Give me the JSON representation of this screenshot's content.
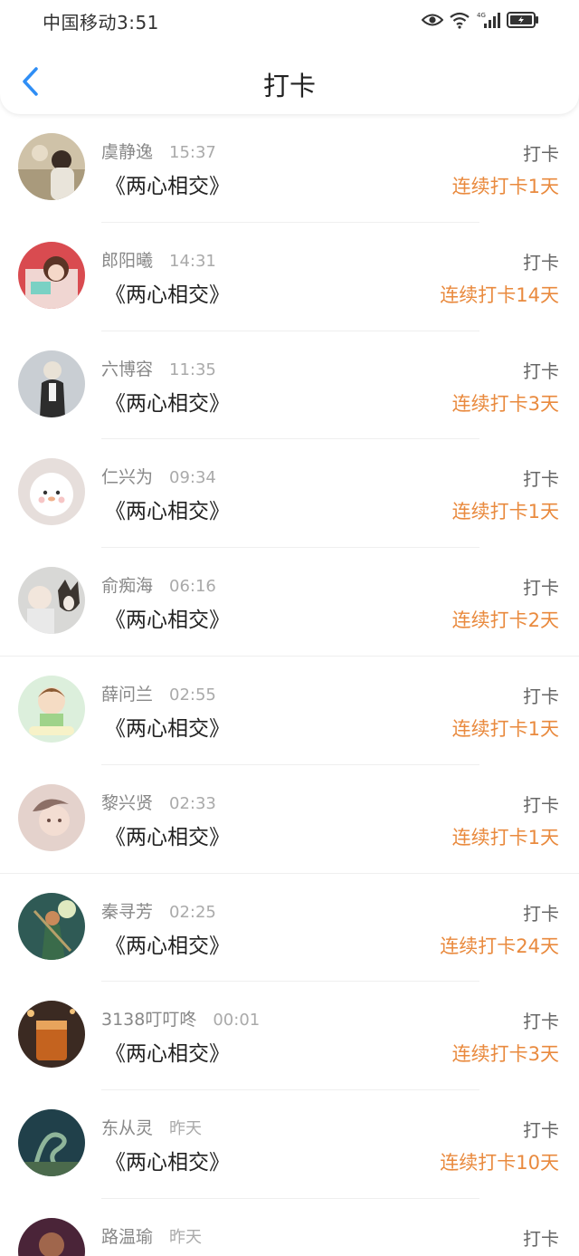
{
  "status_bar": {
    "carrier_time": "中国移动3:51",
    "network": "4G"
  },
  "nav": {
    "title": "打卡"
  },
  "colors": {
    "accent_blue": "#2f8ef5",
    "streak_orange": "#e98a3e"
  },
  "rows": [
    {
      "name": "虞静逸",
      "time": "15:37",
      "book": "《两心相交》",
      "action": "打卡",
      "streak": "连续打卡1天"
    },
    {
      "name": "郎阳曦",
      "time": "14:31",
      "book": "《两心相交》",
      "action": "打卡",
      "streak": "连续打卡14天"
    },
    {
      "name": "六博容",
      "time": "11:35",
      "book": "《两心相交》",
      "action": "打卡",
      "streak": "连续打卡3天"
    },
    {
      "name": "仁兴为",
      "time": "09:34",
      "book": "《两心相交》",
      "action": "打卡",
      "streak": "连续打卡1天"
    },
    {
      "name": "俞痴海",
      "time": "06:16",
      "book": "《两心相交》",
      "action": "打卡",
      "streak": "连续打卡2天"
    },
    {
      "name": "薛问兰",
      "time": "02:55",
      "book": "《两心相交》",
      "action": "打卡",
      "streak": "连续打卡1天"
    },
    {
      "name": "黎兴贤",
      "time": "02:33",
      "book": "《两心相交》",
      "action": "打卡",
      "streak": "连续打卡1天"
    },
    {
      "name": "秦寻芳",
      "time": "02:25",
      "book": "《两心相交》",
      "action": "打卡",
      "streak": "连续打卡24天"
    },
    {
      "name": "3138叮叮咚",
      "time": "00:01",
      "book": "《两心相交》",
      "action": "打卡",
      "streak": "连续打卡3天"
    },
    {
      "name": "东从灵",
      "time": "昨天",
      "book": "《两心相交》",
      "action": "打卡",
      "streak": "连续打卡10天"
    },
    {
      "name": "路温瑜",
      "time": "昨天",
      "book": "",
      "action": "打卡",
      "streak": ""
    }
  ]
}
